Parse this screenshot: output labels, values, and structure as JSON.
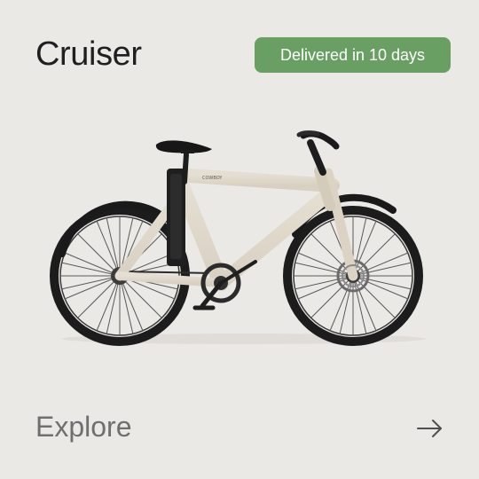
{
  "product": {
    "title": "Cruiser",
    "delivery_badge": "Delivered in 10 days",
    "brand_mark": "COWBOY"
  },
  "cta": {
    "explore_label": "Explore",
    "arrow_icon": "arrow-right-icon"
  },
  "colors": {
    "background": "#ebe9e6",
    "badge_background": "#6a9f63",
    "badge_text": "#ffffff",
    "title_text": "#1f1f1f",
    "explore_text": "#6f6f6f",
    "frame": "#ddd5c7",
    "tire": "#1f1f1f"
  }
}
